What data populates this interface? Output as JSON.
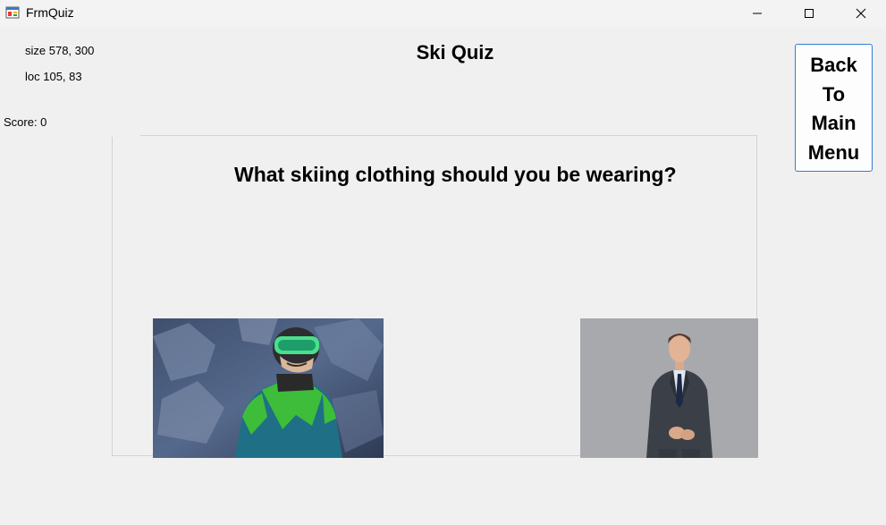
{
  "window": {
    "title": "FrmQuiz"
  },
  "debug": {
    "size_text": "size 578, 300",
    "loc_text": "loc 105, 83"
  },
  "score": {
    "text": "Score: 0"
  },
  "quiz": {
    "title": "Ski Quiz",
    "question": "What skiing clothing should you be wearing?",
    "answers": [
      {
        "name": "ski jacket and goggles",
        "icon": "skier-photo"
      },
      {
        "name": "business suit",
        "icon": "suit-photo"
      }
    ]
  },
  "back_button": {
    "label": "Back\nTo\nMain\nMenu"
  },
  "colors": {
    "background": "#f0f0f0",
    "button_border": "#2f7fd6",
    "jacket_green": "#3dbd3a",
    "jacket_teal": "#1f6f86"
  }
}
